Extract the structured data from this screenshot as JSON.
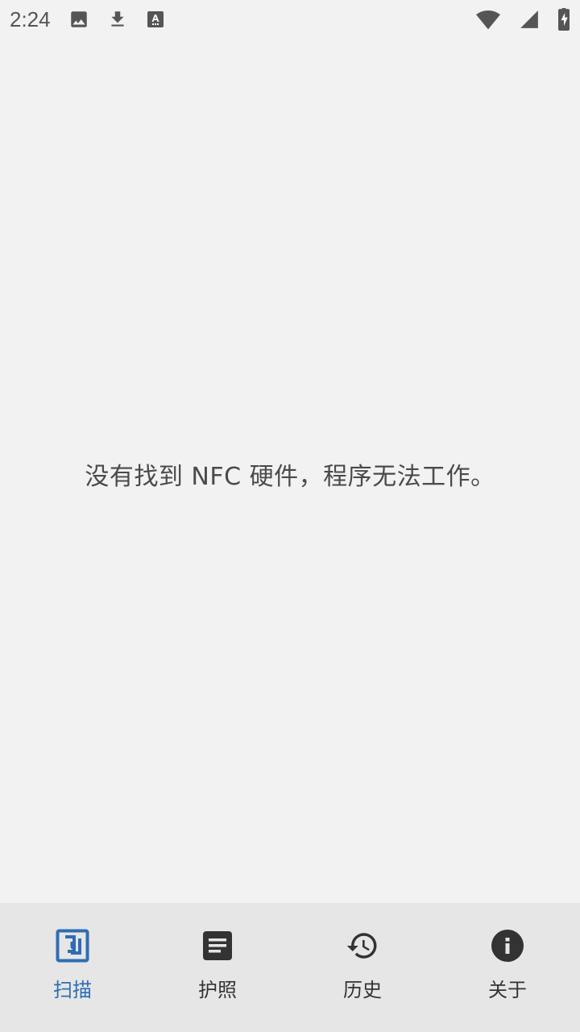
{
  "status_bar": {
    "time": "2:24",
    "left_icons": [
      "image-icon",
      "download-icon",
      "font-icon"
    ],
    "right_icons": [
      "wifi-icon",
      "signal-icon",
      "battery-icon"
    ]
  },
  "main": {
    "message": "没有找到 NFC 硬件，程序无法工作。"
  },
  "bottom_nav": {
    "items": [
      {
        "label": "扫描",
        "icon": "nfc-scan-icon",
        "active": true
      },
      {
        "label": "护照",
        "icon": "passport-document-icon",
        "active": false
      },
      {
        "label": "历史",
        "icon": "history-icon",
        "active": false
      },
      {
        "label": "关于",
        "icon": "info-icon",
        "active": false
      }
    ]
  },
  "colors": {
    "background": "#f2f2f2",
    "nav_background": "#e6e6e6",
    "accent": "#2e6db4",
    "icon": "#333333",
    "text": "#4a4a4a"
  }
}
